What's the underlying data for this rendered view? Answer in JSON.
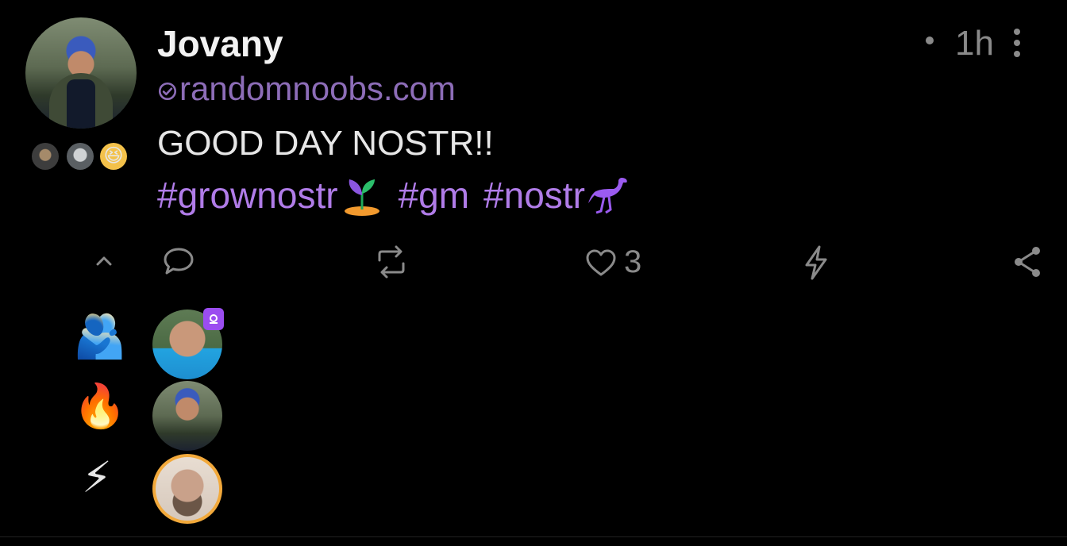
{
  "post": {
    "author_name": "Jovany",
    "nip05": "randomnoobs.com",
    "time": "1h",
    "content": "GOOD DAY NOSTR!!",
    "hashtags": [
      "#grownostr",
      "#gm",
      "#nostr"
    ],
    "like_count": "3"
  },
  "reactions": [
    {
      "emoji": "🫂",
      "icon": "people-hugging-emoji"
    },
    {
      "emoji": "🔥",
      "icon": "fire-emoji"
    },
    {
      "emoji": "⚡",
      "icon": "lightning-emoji"
    }
  ],
  "colors": {
    "background": "#000000",
    "accent": "#b07ce8",
    "nip05": "#8d6db8",
    "muted": "#8a8a8a",
    "zap_ring": "#f2a93b",
    "verified_badge": "#9b4df0"
  },
  "icons": {
    "collapse": "chevron-up-icon",
    "reply": "reply-bubble-icon",
    "repost": "repost-icon",
    "like": "heart-icon",
    "zap": "lightning-icon",
    "share": "share-icon",
    "more": "more-vertical-icon"
  }
}
